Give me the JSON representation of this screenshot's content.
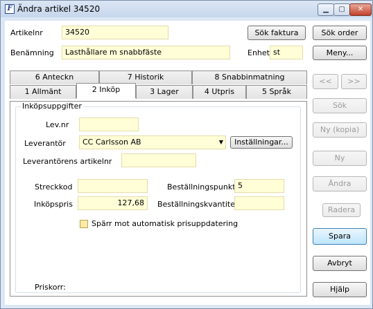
{
  "window": {
    "title": "Ändra artikel 34520",
    "app_icon_letter": "F",
    "controls": {
      "minimize": "▁",
      "maximize": "▢",
      "close": "✕"
    }
  },
  "header": {
    "artikelnr_label": "Artikelnr",
    "artikelnr_value": "34520",
    "benamning_label": "Benämning",
    "benamning_value": "Lasthållare m snabbfäste",
    "enhet_label": "Enhet",
    "enhet_value": "st",
    "sok_faktura": "Sök faktura"
  },
  "tabs": {
    "row_back": [
      "6 Anteckn",
      "7 Historik",
      "8 Snabbinmatning"
    ],
    "row_front": [
      "1 Allmänt",
      "2 Inköp",
      "3 Lager",
      "4 Utpris",
      "5 Språk"
    ],
    "active": "2 Inköp"
  },
  "inkop": {
    "group_title": "Inköpsuppgifter",
    "levnr_label": "Lev.nr",
    "levnr_value": "",
    "leverantor_label": "Leverantör",
    "leverantor_value": "CC Carlsson AB",
    "installningar": "Inställningar...",
    "lev_artikelnr_label": "Leverantörens artikelnr",
    "lev_artikelnr_value": "",
    "streckkod_label": "Streckkod",
    "streckkod_value": "",
    "bestallningspunkt_label": "Beställningspunkt",
    "bestallningspunkt_value": "5",
    "inkopspris_label": "Inköpspris",
    "inkopspris_value": "127,68",
    "bestallningskvantitet_label": "Beställningskvantitet",
    "bestallningskvantitet_value": "",
    "sparr_label": "Spärr mot automatisk prisuppdatering",
    "sparr_checked": false,
    "priskorr_label": "Priskorr:"
  },
  "sidebar": {
    "sok_order": "Sök order",
    "meny": "Meny...",
    "prev": "<<",
    "next": ">>",
    "sok": "Sök",
    "ny_kopia": "Ny (kopia)",
    "ny": "Ny",
    "andra": "Ändra",
    "radera": "Radera",
    "spara": "Spara",
    "avbryt": "Avbryt",
    "hjalp": "Hjälp"
  }
}
